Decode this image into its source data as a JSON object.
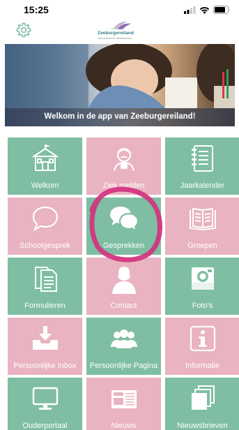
{
  "status": {
    "time": "15:25"
  },
  "header": {
    "logo_title": "Zeeburgereiland",
    "logo_subtitle": "Oecumenische Basisschool"
  },
  "hero": {
    "caption": "Welkom in de app van Zeeburgereiland!"
  },
  "colors": {
    "green_tile": "#7fbea3",
    "pink_tile": "#e9b3c1",
    "highlight_circle": "#d2327e"
  },
  "tiles": [
    {
      "label": "Welkom",
      "icon": "school-building-icon",
      "color": "green"
    },
    {
      "label": "Ziek melden",
      "icon": "sick-child-icon",
      "color": "pink"
    },
    {
      "label": "Jaarkalender",
      "icon": "notebook-icon",
      "color": "green"
    },
    {
      "label": "Schoolgesprek",
      "icon": "speech-bubble-icon",
      "color": "pink"
    },
    {
      "label": "Gesprekken",
      "icon": "chat-bubbles-icon",
      "color": "green"
    },
    {
      "label": "Groepen",
      "icon": "open-book-icon",
      "color": "pink"
    },
    {
      "label": "Formulieren",
      "icon": "documents-icon",
      "color": "green"
    },
    {
      "label": "Contact",
      "icon": "contact-person-icon",
      "color": "pink"
    },
    {
      "label": "Foto's",
      "icon": "camera-icon",
      "color": "green"
    },
    {
      "label": "Persoonlijke Inbox",
      "icon": "inbox-tray-icon",
      "color": "pink"
    },
    {
      "label": "Persoonlijke Pagina",
      "icon": "people-group-icon",
      "color": "green"
    },
    {
      "label": "Informatie",
      "icon": "info-icon",
      "color": "pink"
    },
    {
      "label": "Ouderportaal",
      "icon": "monitor-icon",
      "color": "green"
    },
    {
      "label": "Nieuws",
      "icon": "newspaper-icon",
      "color": "pink"
    },
    {
      "label": "Nieuwsbrieven",
      "icon": "stacked-pages-icon",
      "color": "green"
    }
  ]
}
